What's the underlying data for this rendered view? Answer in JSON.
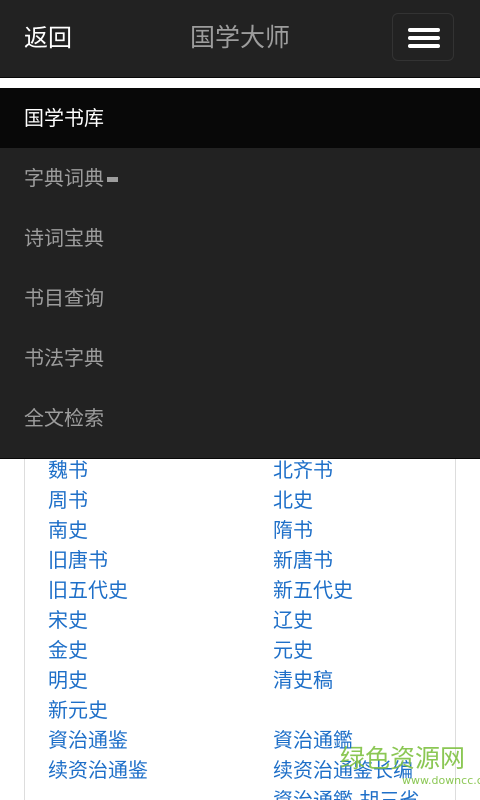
{
  "header": {
    "back_label": "返回",
    "title": "国学大师",
    "menu_icon": "hamburger-menu-icon"
  },
  "nav": {
    "items": [
      {
        "label": "国学书库",
        "active": true
      },
      {
        "label": "字典词典",
        "has_caret": true
      },
      {
        "label": "诗词宝典"
      },
      {
        "label": "书目查询"
      },
      {
        "label": "书法字典"
      },
      {
        "label": "全文检索"
      }
    ]
  },
  "books": {
    "rows": [
      [
        "魏书",
        "北齐书"
      ],
      [
        "周书",
        "北史"
      ],
      [
        "南史",
        "隋书"
      ],
      [
        "旧唐书",
        "新唐书"
      ],
      [
        "旧五代史",
        "新五代史"
      ],
      [
        "宋史",
        "辽史"
      ],
      [
        "金史",
        "元史"
      ],
      [
        "明史",
        "清史稿"
      ],
      [
        "新元史",
        ""
      ],
      [
        "資治通鉴",
        "資治通鑑"
      ],
      [
        "续资治通鉴",
        "续资治通鉴长编"
      ],
      [
        "",
        "資治通鑑 胡三省"
      ]
    ]
  },
  "watermark": {
    "text": "绿色资源网",
    "url": "www.downcc.com"
  },
  "colors": {
    "navbar_bg": "#222222",
    "nav_active_bg": "#080808",
    "nav_text": "#9d9d9d",
    "link": "#1e6fc8",
    "watermark": "#7fc142"
  }
}
